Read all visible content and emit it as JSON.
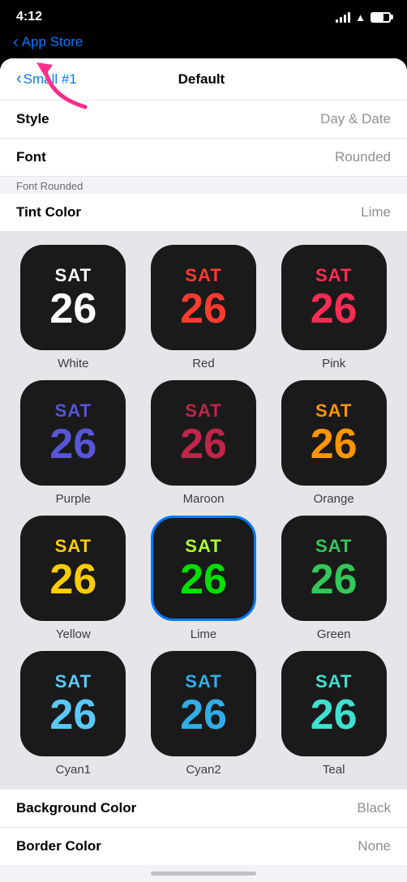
{
  "statusBar": {
    "time": "4:12",
    "appStore": "App Store"
  },
  "navigation": {
    "backLabel": "Small #1",
    "title": "Default"
  },
  "settingsRows": [
    {
      "label": "Style",
      "value": "Day & Date"
    },
    {
      "label": "Font",
      "value": "Rounded"
    }
  ],
  "fontRoundedNote": "Font Rounded",
  "tintColor": {
    "label": "Tint Color",
    "value": "Lime"
  },
  "colorItems": [
    {
      "day": "SAT",
      "date": "26",
      "label": "White",
      "dayColor": "#ffffff",
      "dateColor": "#ffffff",
      "selected": false
    },
    {
      "day": "SAT",
      "date": "26",
      "label": "Red",
      "dayColor": "#ff3b30",
      "dateColor": "#ff3b30",
      "selected": false
    },
    {
      "day": "SAT",
      "date": "26",
      "label": "Pink",
      "dayColor": "#ff2d55",
      "dateColor": "#ff2d55",
      "selected": false
    },
    {
      "day": "SAT",
      "date": "26",
      "label": "Purple",
      "dayColor": "#5856d6",
      "dateColor": "#5856d6",
      "selected": false
    },
    {
      "day": "SAT",
      "date": "26",
      "label": "Maroon",
      "dayColor": "#c0254a",
      "dateColor": "#c0254a",
      "selected": false
    },
    {
      "day": "SAT",
      "date": "26",
      "label": "Orange",
      "dayColor": "#ff9500",
      "dateColor": "#ff9500",
      "selected": false
    },
    {
      "day": "SAT",
      "date": "26",
      "label": "Yellow",
      "dayColor": "#ffcc00",
      "dateColor": "#ffcc00",
      "selected": false
    },
    {
      "day": "SAT",
      "date": "26",
      "label": "Lime",
      "dayColor": "#adff2f",
      "dateColor": "#32cd32",
      "selected": true
    },
    {
      "day": "SAT",
      "date": "26",
      "label": "Green",
      "dayColor": "#34c759",
      "dateColor": "#34c759",
      "selected": false
    },
    {
      "day": "SAT",
      "date": "26",
      "label": "Cyan1",
      "dayColor": "#5ac8fa",
      "dateColor": "#5ac8fa",
      "selected": false
    },
    {
      "day": "SAT",
      "date": "26",
      "label": "Cyan2",
      "dayColor": "#32ade6",
      "dateColor": "#32ade6",
      "selected": false
    },
    {
      "day": "SAT",
      "date": "26",
      "label": "Teal",
      "dayColor": "#40e0d0",
      "dateColor": "#40e0d0",
      "selected": false
    }
  ],
  "bottomRows": [
    {
      "label": "Background Color",
      "value": "Black"
    },
    {
      "label": "Border Color",
      "value": "None"
    }
  ]
}
